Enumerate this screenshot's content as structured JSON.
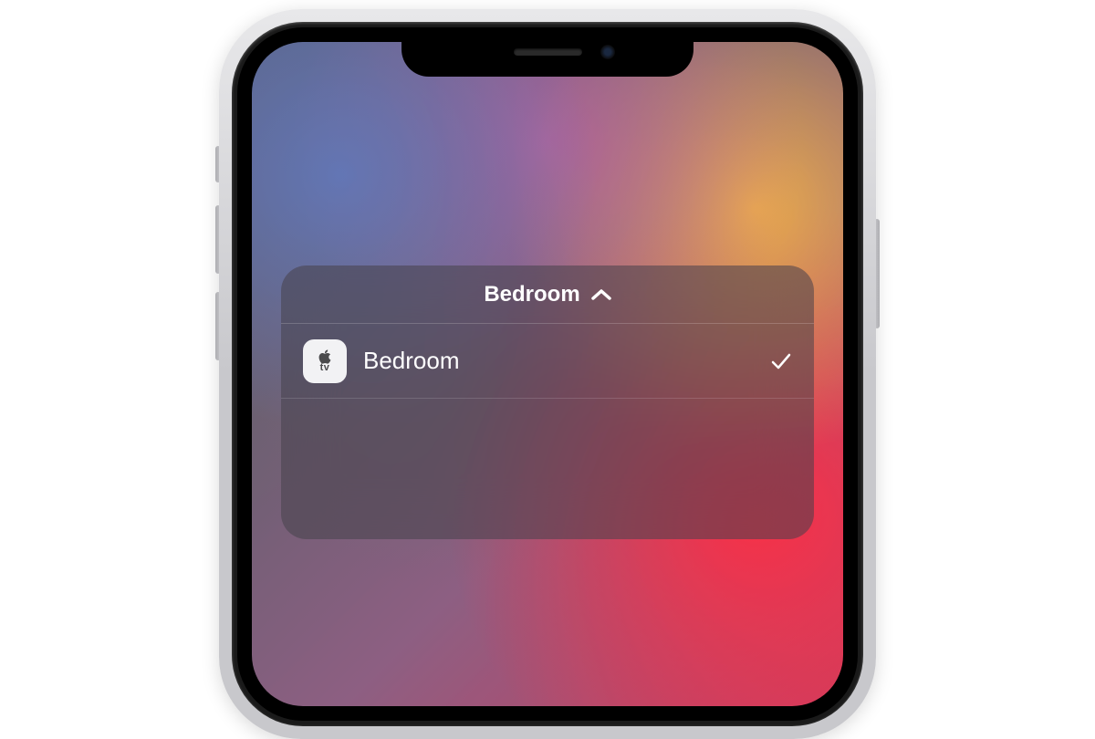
{
  "remote_panel": {
    "title": "Bedroom",
    "devices": [
      {
        "type": "appletv",
        "label": "Bedroom",
        "selected": true
      }
    ],
    "icon_label_top": "",
    "icon_label_bottom": "tv"
  }
}
